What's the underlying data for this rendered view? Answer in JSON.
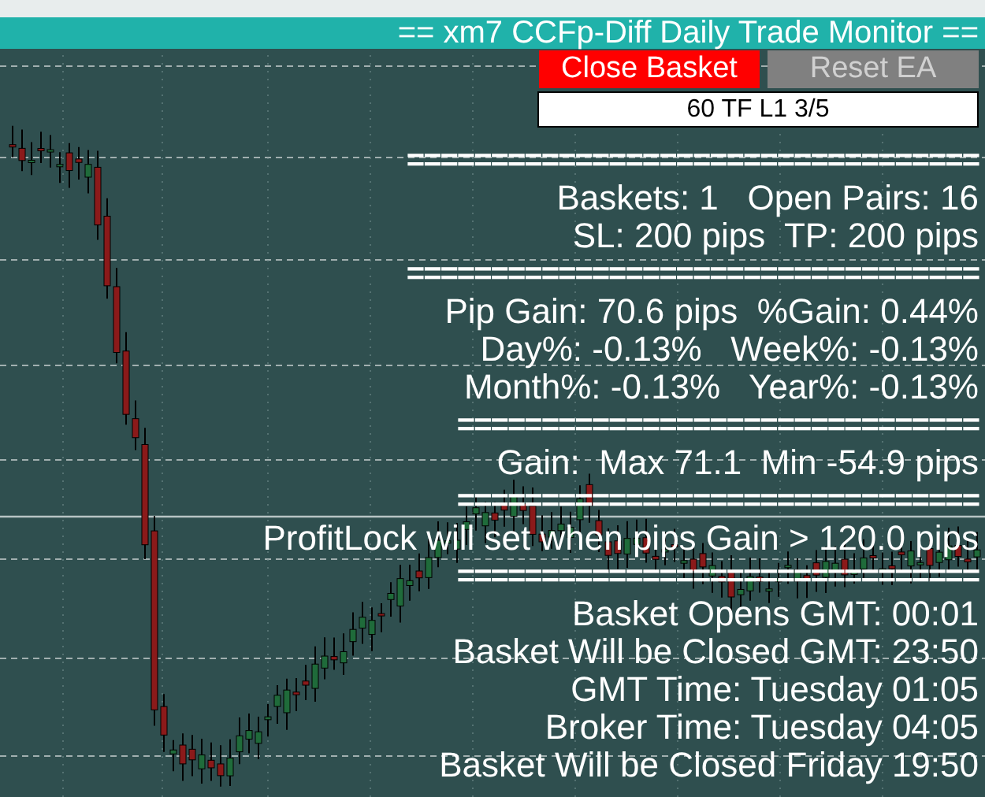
{
  "title": "== xm7 CCFp-Diff Daily Trade Monitor ==",
  "buttons": [
    {
      "label": "Close Basket",
      "kind": "danger"
    },
    {
      "label": "Reset EA",
      "kind": "muted"
    }
  ],
  "timeframe": "60 TF L1 3/5",
  "lines": [
    {
      "kind": "separator",
      "text": "=================================="
    },
    {
      "kind": "text",
      "text": "Baskets: 1   Open Pairs: 16"
    },
    {
      "kind": "text",
      "text": "SL: 200 pips  TP: 200 pips"
    },
    {
      "kind": "separator",
      "text": "=================================="
    },
    {
      "kind": "text",
      "text": "Pip Gain: 70.6 pips  %Gain: 0.44%"
    },
    {
      "kind": "text",
      "text": "Day%: -0.13%   Week%: -0.13%"
    },
    {
      "kind": "text",
      "text": "Month%: -0.13%   Year%: -0.13%"
    },
    {
      "kind": "separator",
      "text": "==============================="
    },
    {
      "kind": "text",
      "text": "Gain:  Max 71.1  Min -54.9 pips"
    },
    {
      "kind": "separator",
      "text": "==============================="
    },
    {
      "kind": "text",
      "text": "ProfitLock will set when pips Gain > 120.0 pips"
    },
    {
      "kind": "separator",
      "text": "==============================="
    },
    {
      "kind": "text",
      "text": "Basket Opens GMT: 00:01"
    },
    {
      "kind": "text",
      "text": "Basket Will be Closed GMT: 23:50"
    },
    {
      "kind": "text",
      "text": "GMT Time: Tuesday 01:05"
    },
    {
      "kind": "text",
      "text": "Broker Time: Tuesday 04:05"
    },
    {
      "kind": "text",
      "text": "Basket Will be Closed Friday 19:50"
    }
  ]
}
